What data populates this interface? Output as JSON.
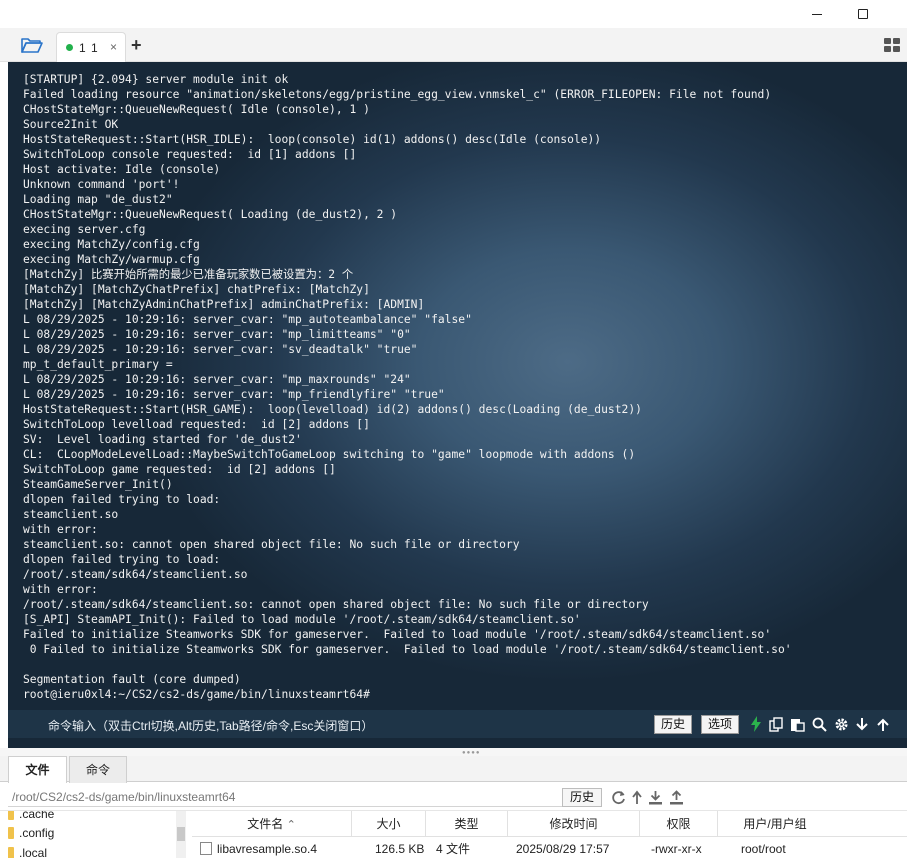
{
  "tabs": {
    "session_label": "1 1",
    "close_glyph": "×",
    "add_glyph": "+"
  },
  "terminal": {
    "lines": [
      "[STARTUP] {2.094} server module init ok",
      "Failed loading resource \"animation/skeletons/egg/pristine_egg_view.vnmskel_c\" (ERROR_FILEOPEN: File not found)",
      "CHostStateMgr::QueueNewRequest( Idle (console), 1 )",
      "Source2Init OK",
      "HostStateRequest::Start(HSR_IDLE):  loop(console) id(1) addons() desc(Idle (console))",
      "SwitchToLoop console requested:  id [1] addons []",
      "Host activate: Idle (console)",
      "Unknown command 'port'!",
      "Loading map \"de_dust2\"",
      "CHostStateMgr::QueueNewRequest( Loading (de_dust2), 2 )",
      "execing server.cfg",
      "execing MatchZy/config.cfg",
      "execing MatchZy/warmup.cfg",
      "[MatchZy] 比赛开始所需的最少已准备玩家数已被设置为：2 个",
      "[MatchZy] [MatchZyChatPrefix] chatPrefix: [MatchZy]",
      "[MatchZy] [MatchZyAdminChatPrefix] adminChatPrefix: [ADMIN]",
      "L 08/29/2025 - 10:29:16: server_cvar: \"mp_autoteambalance\" \"false\"",
      "L 08/29/2025 - 10:29:16: server_cvar: \"mp_limitteams\" \"0\"",
      "L 08/29/2025 - 10:29:16: server_cvar: \"sv_deadtalk\" \"true\"",
      "mp_t_default_primary =",
      "L 08/29/2025 - 10:29:16: server_cvar: \"mp_maxrounds\" \"24\"",
      "L 08/29/2025 - 10:29:16: server_cvar: \"mp_friendlyfire\" \"true\"",
      "HostStateRequest::Start(HSR_GAME):  loop(levelload) id(2) addons() desc(Loading (de_dust2))",
      "SwitchToLoop levelload requested:  id [2] addons []",
      "SV:  Level loading started for 'de_dust2'",
      "CL:  CLoopModeLevelLoad::MaybeSwitchToGameLoop switching to \"game\" loopmode with addons ()",
      "SwitchToLoop game requested:  id [2] addons []",
      "SteamGameServer_Init()",
      "dlopen failed trying to load:",
      "steamclient.so",
      "with error:",
      "steamclient.so: cannot open shared object file: No such file or directory",
      "dlopen failed trying to load:",
      "/root/.steam/sdk64/steamclient.so",
      "with error:",
      "/root/.steam/sdk64/steamclient.so: cannot open shared object file: No such file or directory",
      "[S_API] SteamAPI_Init(): Failed to load module '/root/.steam/sdk64/steamclient.so'",
      "Failed to initialize Steamworks SDK for gameserver.  Failed to load module '/root/.steam/sdk64/steamclient.so'",
      " 0 Failed to initialize Steamworks SDK for gameserver.  Failed to load module '/root/.steam/sdk64/steamclient.so'",
      "",
      "Segmentation fault (core dumped)",
      "root@ieru0xl4:~/CS2/cs2-ds/game/bin/linuxsteamrt64#"
    ]
  },
  "command_bar": {
    "hint": "命令输入（双击Ctrl切换,Alt历史,Tab路径/命令,Esc关闭窗口）",
    "history_label": "历史",
    "options_label": "选项"
  },
  "bottom_tabs": {
    "files_label": "文件",
    "commands_label": "命令"
  },
  "path_bar": {
    "path": "/root/CS2/cs2-ds/game/bin/linuxsteamrt64",
    "history_label": "历史"
  },
  "tree": {
    "items": [
      ".cache",
      ".config",
      ".local"
    ]
  },
  "file_table": {
    "headers": {
      "name": "文件名",
      "name_sort_glyph": "⌃",
      "size": "大小",
      "type": "类型",
      "modified": "修改时间",
      "permissions": "权限",
      "owner": "用户/用户组"
    },
    "rows": [
      {
        "name": "libavresample.so.4",
        "size": "126.5 KB",
        "type": "4 文件",
        "modified": "2025/08/29 17:57",
        "permissions": "-rwxr-xr-x",
        "owner": "root/root"
      }
    ]
  },
  "colors": {
    "terminal_bg": "#2b4862",
    "terminal_text": "#f2f2f2",
    "active_dot": "#22b14c",
    "lightning": "#2bb24c",
    "folder": "#f0c24b"
  },
  "icons": {
    "minimize": "minimize-icon",
    "maximize": "maximize-icon",
    "open_folder": "folder-open-icon",
    "layout": "grid-icon",
    "lightning": "lightning-icon",
    "copy": "copy-icon",
    "paste": "paste-icon",
    "search": "search-icon",
    "settings": "gear-icon",
    "download": "download-arrow-icon",
    "upload": "upload-arrow-icon",
    "refresh": "refresh-icon",
    "parent": "up-arrow-icon"
  }
}
